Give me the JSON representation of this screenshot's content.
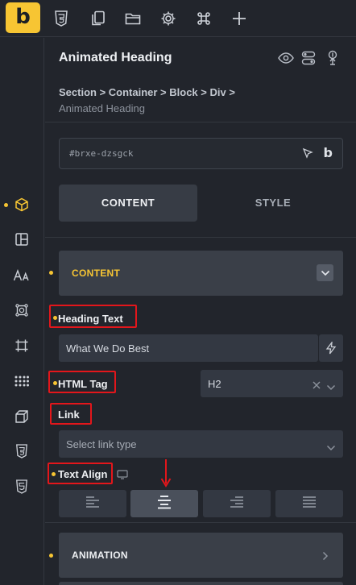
{
  "app": {
    "logo_letter": "b",
    "accent_color": "#f7c533"
  },
  "toolbar": {
    "icons": [
      "css3-icon",
      "copy-pages-icon",
      "folder-icon",
      "gear-icon",
      "command-icon",
      "plus-icon"
    ]
  },
  "rail": {
    "icons": [
      "box-icon",
      "layout-icon",
      "typography-icon",
      "frame-icon",
      "crop-icon",
      "dots-grid-icon",
      "cube-icon",
      "css3-icon",
      "html5-icon"
    ],
    "active": "box-icon"
  },
  "panel": {
    "title": "Animated Heading",
    "breadcrumb_path": "Section > Container > Block > Div >",
    "breadcrumb_current": "Animated Heading",
    "element_id": "#brxe-dzsgck",
    "tabs": {
      "content": "CONTENT",
      "style": "STYLE"
    },
    "sections": {
      "content": "CONTENT",
      "animation": "ANIMATION"
    },
    "content_section_color": "#f7c533",
    "fields": {
      "heading_text_label": "Heading Text",
      "heading_text_value": "What We Do Best",
      "html_tag_label": "HTML Tag",
      "html_tag_value": "H2",
      "link_label": "Link",
      "link_placeholder": "Select link type",
      "text_align_label": "Text Align"
    },
    "annotation_color": "#e3161b"
  }
}
